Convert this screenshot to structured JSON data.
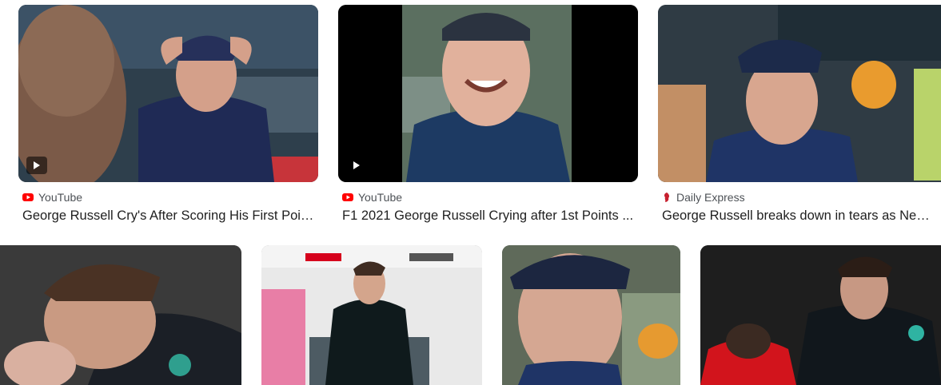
{
  "results_top": [
    {
      "source": "YouTube",
      "source_icon": "youtube-icon",
      "title": "George Russell Cry's After Scoring His First Points For ...",
      "has_play": true
    },
    {
      "source": "YouTube",
      "source_icon": "youtube-icon",
      "title": "F1 2021 George Russell Crying after 1st Points ...",
      "has_play": true
    },
    {
      "source": "Daily Express",
      "source_icon": "daily-express-icon",
      "title": "George Russell breaks down in tears as New ...",
      "has_play": false
    }
  ],
  "colors": {
    "youtube_red": "#ff0000",
    "express_red": "#c7202f",
    "text_dark": "#1f1f1f",
    "text_source": "#4d5156"
  }
}
